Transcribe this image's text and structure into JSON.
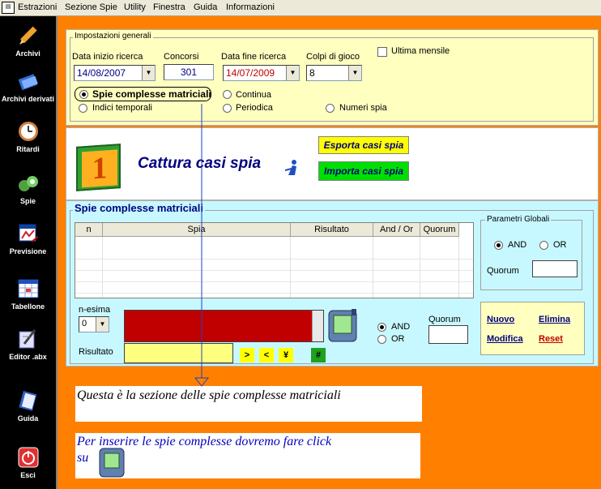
{
  "menu": {
    "items": [
      "Estrazioni",
      "Sezione Spie",
      "Utility",
      "Finestra",
      "Guida",
      "Informazioni"
    ]
  },
  "sidebar": {
    "items": [
      {
        "label": "Archivi",
        "icon": "pencil-icon"
      },
      {
        "label": "Archivi derivati",
        "icon": "books-icon"
      },
      {
        "label": "Ritardi",
        "icon": "clock-icon"
      },
      {
        "label": "Spie",
        "icon": "binoculars-icon"
      },
      {
        "label": "Previsione",
        "icon": "chart-icon"
      },
      {
        "label": "Tabellone",
        "icon": "grid-icon"
      },
      {
        "label": "Editor .abx",
        "icon": "pen-icon"
      },
      {
        "label": "Guida",
        "icon": "book-icon"
      },
      {
        "label": "Esci",
        "icon": "power-icon"
      }
    ]
  },
  "impostazioni": {
    "legend": "Impostazioni generali",
    "data_inizio_label": "Data inizio ricerca",
    "data_inizio_value": "14/08/2007",
    "concorsi_label": "Concorsi",
    "concorsi_value": "301",
    "data_fine_label": "Data fine ricerca",
    "data_fine_value": "14/07/2009",
    "colpi_label": "Colpi di gioco",
    "colpi_value": "8",
    "ultima_mensile_label": "Ultima mensile",
    "radio_spie_complesse": "Spie complesse matriciali",
    "radio_continua": "Continua",
    "radio_indici": "Indici temporali",
    "radio_periodica": "Periodica",
    "radio_numeri_spia": "Numeri spia"
  },
  "cattura": {
    "step_number": "1",
    "title": "Cattura casi spia",
    "esporta_label": "Esporta casi spia",
    "importa_label": "Importa casi spia"
  },
  "spie_complesse": {
    "legend": "Spie complesse matriciali",
    "columns": [
      "n",
      "Spia",
      "Risultato",
      "And / Or",
      "Quorum"
    ],
    "parametri_legend": "Parametri Globali",
    "and_label": "AND",
    "or_label": "OR",
    "quorum_label": "Quorum",
    "n_esima_label": "n-esima",
    "n_esima_value": "0",
    "risultato_label": "Risultato",
    "btn_gt": ">",
    "btn_lt": "<",
    "btn_yen": "¥",
    "btn_hash": "#",
    "and2_label": "AND",
    "or2_label": "OR",
    "quorum2_label": "Quorum",
    "nuovo_label": "Nuovo",
    "elimina_label": "Elimina",
    "modifica_label": "Modifica",
    "reset_label": "Reset"
  },
  "notes": {
    "note1": "Questa è la sezione delle spie complesse matriciali",
    "note2_line1": "Per inserire le spie complesse dovremo fare click",
    "note2_line2": "su"
  },
  "colors": {
    "orange": "#ff8000",
    "yellow_panel": "#ffffc0",
    "cyan_panel": "#c8f8ff",
    "dark_red": "#c00000",
    "blue_title": "#000080"
  }
}
